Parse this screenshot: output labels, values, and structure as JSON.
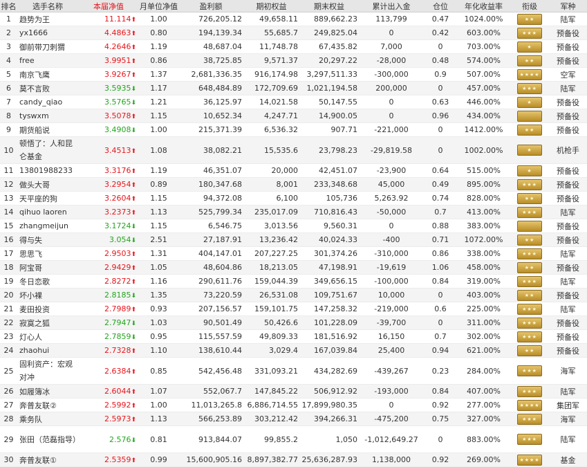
{
  "columns": [
    "排名",
    "选手名称",
    "本届净值",
    "月单位净值",
    "盈利额",
    "期初权益",
    "期末权益",
    "累计出入金",
    "仓位",
    "年化收益率",
    "衔级",
    "军种"
  ],
  "rows": [
    {
      "rank": "1",
      "name": "趋势为王",
      "nav": "11.114",
      "dir": "up",
      "mnav": "1.00",
      "profit": "726,205.12",
      "start": "49,658.11",
      "end": "889,662.23",
      "flow": "113,799",
      "pos": "0.47",
      "annual": "1024.00%",
      "rank_badge": "★★",
      "branch": "陆军"
    },
    {
      "rank": "2",
      "name": "yx1666",
      "nav": "4.4863",
      "dir": "up",
      "mnav": "0.80",
      "profit": "194,139.34",
      "start": "55,685.7",
      "end": "249,825.04",
      "flow": "0",
      "pos": "0.42",
      "annual": "603.00%",
      "rank_badge": "★★★",
      "branch": "预备役"
    },
    {
      "rank": "3",
      "name": "御前带刀刺猬",
      "nav": "4.2646",
      "dir": "up",
      "mnav": "1.19",
      "profit": "48,687.04",
      "start": "11,748.78",
      "end": "67,435.82",
      "flow": "7,000",
      "pos": "0",
      "annual": "703.00%",
      "rank_badge": "★",
      "branch": "预备役"
    },
    {
      "rank": "4",
      "name": "free",
      "nav": "3.9951",
      "dir": "up",
      "mnav": "0.86",
      "profit": "38,725.85",
      "start": "9,571.37",
      "end": "20,297.22",
      "flow": "-28,000",
      "pos": "0.48",
      "annual": "574.00%",
      "rank_badge": "★★",
      "branch": "预备役"
    },
    {
      "rank": "5",
      "name": "南京飞鹰",
      "nav": "3.9267",
      "dir": "up",
      "mnav": "1.37",
      "profit": "2,681,336.35",
      "start": "916,174.98",
      "end": "3,297,511.33",
      "flow": "-300,000",
      "pos": "0.9",
      "annual": "507.00%",
      "rank_badge": "★★★★",
      "branch": "空军"
    },
    {
      "rank": "6",
      "name": "莫不言败",
      "nav": "3.5935",
      "dir": "dn",
      "mnav": "1.17",
      "profit": "648,484.89",
      "start": "172,709.69",
      "end": "1,021,194.58",
      "flow": "200,000",
      "pos": "0",
      "annual": "457.00%",
      "rank_badge": "★★★",
      "branch": "陆军"
    },
    {
      "rank": "7",
      "name": "candy_qiao",
      "nav": "3.5765",
      "dir": "dn",
      "mnav": "1.21",
      "profit": "36,125.97",
      "start": "14,021.58",
      "end": "50,147.55",
      "flow": "0",
      "pos": "0.63",
      "annual": "446.00%",
      "rank_badge": "★",
      "branch": "预备役"
    },
    {
      "rank": "8",
      "name": "tyswxm",
      "nav": "3.5078",
      "dir": "up",
      "mnav": "1.15",
      "profit": "10,652.34",
      "start": "4,247.71",
      "end": "14,900.05",
      "flow": "0",
      "pos": "0.96",
      "annual": "434.00%",
      "rank_badge": "",
      "branch": "预备役"
    },
    {
      "rank": "9",
      "name": "期货船说",
      "nav": "3.4908",
      "dir": "dn",
      "mnav": "1.00",
      "profit": "215,371.39",
      "start": "6,536.32",
      "end": "907.71",
      "flow": "-221,000",
      "pos": "0",
      "annual": "1412.00%",
      "rank_badge": "★★",
      "branch": "预备役"
    },
    {
      "rank": "10",
      "name": "顿悟了：人和昆仑基金",
      "nav": "3.4513",
      "dir": "up",
      "mnav": "1.08",
      "profit": "38,082.21",
      "start": "15,535.6",
      "end": "23,798.23",
      "flow": "-29,819.58",
      "pos": "0",
      "annual": "1002.00%",
      "rank_badge": "★",
      "branch": "机枪手",
      "tall": true
    },
    {
      "rank": "11",
      "name": "13801988233",
      "nav": "3.3176",
      "dir": "up",
      "mnav": "1.19",
      "profit": "46,351.07",
      "start": "20,000",
      "end": "42,451.07",
      "flow": "-23,900",
      "pos": "0.64",
      "annual": "515.00%",
      "rank_badge": "★",
      "branch": "预备役"
    },
    {
      "rank": "12",
      "name": "做头大哥",
      "nav": "3.2954",
      "dir": "up",
      "mnav": "0.89",
      "profit": "180,347.68",
      "start": "8,001",
      "end": "233,348.68",
      "flow": "45,000",
      "pos": "0.49",
      "annual": "895.00%",
      "rank_badge": "★★★",
      "branch": "预备役"
    },
    {
      "rank": "13",
      "name": "天平座的狗",
      "nav": "3.2604",
      "dir": "up",
      "mnav": "1.15",
      "profit": "94,372.08",
      "start": "6,100",
      "end": "105,736",
      "flow": "5,263.92",
      "pos": "0.74",
      "annual": "828.00%",
      "rank_badge": "★★",
      "branch": "预备役"
    },
    {
      "rank": "14",
      "name": "qihuo laoren",
      "nav": "3.2373",
      "dir": "up",
      "mnav": "1.13",
      "profit": "525,799.34",
      "start": "235,017.09",
      "end": "710,816.43",
      "flow": "-50,000",
      "pos": "0.7",
      "annual": "413.00%",
      "rank_badge": "★★★",
      "branch": "陆军"
    },
    {
      "rank": "15",
      "name": "zhangmeijun",
      "nav": "3.1724",
      "dir": "dn",
      "mnav": "1.15",
      "profit": "6,546.75",
      "start": "3,013.56",
      "end": "9,560.31",
      "flow": "0",
      "pos": "0.88",
      "annual": "383.00%",
      "rank_badge": "",
      "branch": "预备役"
    },
    {
      "rank": "16",
      "name": "得与失",
      "nav": "3.054",
      "dir": "dn",
      "mnav": "2.51",
      "profit": "27,187.91",
      "start": "13,236.42",
      "end": "40,024.33",
      "flow": "-400",
      "pos": "0.71",
      "annual": "1072.00%",
      "rank_badge": "★★",
      "branch": "预备役"
    },
    {
      "rank": "17",
      "name": "思思飞",
      "nav": "2.9503",
      "dir": "up",
      "mnav": "1.31",
      "profit": "404,147.01",
      "start": "207,227.25",
      "end": "301,374.26",
      "flow": "-310,000",
      "pos": "0.86",
      "annual": "338.00%",
      "rank_badge": "★★★",
      "branch": "陆军"
    },
    {
      "rank": "18",
      "name": "阿宝哥",
      "nav": "2.9429",
      "dir": "up",
      "mnav": "1.05",
      "profit": "48,604.86",
      "start": "18,213.05",
      "end": "47,198.91",
      "flow": "-19,619",
      "pos": "1.06",
      "annual": "458.00%",
      "rank_badge": "★★",
      "branch": "预备役"
    },
    {
      "rank": "19",
      "name": "冬日恋歌",
      "nav": "2.8272",
      "dir": "up",
      "mnav": "1.16",
      "profit": "290,611.76",
      "start": "159,044.39",
      "end": "349,656.15",
      "flow": "-100,000",
      "pos": "0.84",
      "annual": "319.00%",
      "rank_badge": "★★★",
      "branch": "陆军"
    },
    {
      "rank": "20",
      "name": "坏小裸",
      "nav": "2.8185",
      "dir": "dn",
      "mnav": "1.35",
      "profit": "73,220.59",
      "start": "26,531.08",
      "end": "109,751.67",
      "flow": "10,000",
      "pos": "0",
      "annual": "403.00%",
      "rank_badge": "★★",
      "branch": "预备役"
    },
    {
      "rank": "21",
      "name": "麦田投资",
      "nav": "2.7989",
      "dir": "up",
      "mnav": "0.93",
      "profit": "207,156.57",
      "start": "159,101.75",
      "end": "147,258.32",
      "flow": "-219,000",
      "pos": "0.6",
      "annual": "225.00%",
      "rank_badge": "★★★",
      "branch": "陆军"
    },
    {
      "rank": "22",
      "name": "寂寞之狐",
      "nav": "2.7947",
      "dir": "dn",
      "mnav": "1.03",
      "profit": "90,501.49",
      "start": "50,426.6",
      "end": "101,228.09",
      "flow": "-39,700",
      "pos": "0",
      "annual": "311.00%",
      "rank_badge": "★★★",
      "branch": "预备役"
    },
    {
      "rank": "23",
      "name": "灯心人",
      "nav": "2.7859",
      "dir": "dn",
      "mnav": "0.95",
      "profit": "115,557.59",
      "start": "49,809.33",
      "end": "181,516.92",
      "flow": "16,150",
      "pos": "0.7",
      "annual": "302.00%",
      "rank_badge": "★★★",
      "branch": "预备役"
    },
    {
      "rank": "24",
      "name": "zhaohui",
      "nav": "2.7328",
      "dir": "up",
      "mnav": "1.10",
      "profit": "138,610.44",
      "start": "3,029.4",
      "end": "167,039.84",
      "flow": "25,400",
      "pos": "0.94",
      "annual": "621.00%",
      "rank_badge": "★★",
      "branch": "预备役"
    },
    {
      "rank": "25",
      "name": "固利资产：宏观对冲",
      "nav": "2.6384",
      "dir": "up",
      "mnav": "0.85",
      "profit": "542,456.48",
      "start": "331,093.21",
      "end": "434,282.69",
      "flow": "-439,267",
      "pos": "0.23",
      "annual": "284.00%",
      "rank_badge": "★★★",
      "branch": "海军",
      "tall": true
    },
    {
      "rank": "26",
      "name": "如履簿冰",
      "nav": "2.6044",
      "dir": "up",
      "mnav": "1.07",
      "profit": "552,067.7",
      "start": "147,845.22",
      "end": "506,912.92",
      "flow": "-193,000",
      "pos": "0.84",
      "annual": "407.00%",
      "rank_badge": "★★★",
      "branch": "陆军"
    },
    {
      "rank": "27",
      "name": "奔普友联②",
      "nav": "2.5992",
      "dir": "up",
      "mnav": "1.00",
      "profit": "11,013,265.8",
      "start": "6,886,714.55",
      "end": "17,899,980.35",
      "flow": "0",
      "pos": "0.92",
      "annual": "277.00%",
      "rank_badge": "★★★★",
      "branch": "集团军"
    },
    {
      "rank": "28",
      "name": "乘务队",
      "nav": "2.5973",
      "dir": "up",
      "mnav": "1.13",
      "profit": "566,253.89",
      "start": "303,212.42",
      "end": "394,266.31",
      "flow": "-475,200",
      "pos": "0.75",
      "annual": "327.00%",
      "rank_badge": "★★★",
      "branch": "海军"
    },
    {
      "rank": "29",
      "name": "张田（范磊指导）",
      "nav": "2.576",
      "dir": "dn",
      "mnav": "0.81",
      "profit": "913,844.07",
      "start": "99,855.2",
      "end": "1,050",
      "flow": "-1,012,649.27",
      "pos": "0",
      "annual": "883.00%",
      "rank_badge": "★★★",
      "branch": "陆军",
      "tall": true
    },
    {
      "rank": "30",
      "name": "奔普友联①",
      "nav": "2.5359",
      "dir": "up",
      "mnav": "0.99",
      "profit": "15,600,905.16",
      "start": "8,897,382.77",
      "end": "25,636,287.93",
      "flow": "1,138,000",
      "pos": "0.92",
      "annual": "269.00%",
      "rank_badge": "★★★★",
      "branch": "基金"
    }
  ],
  "colors": {
    "up": "#e8141b",
    "down": "#22a51e",
    "badge": "#d2ab4a"
  }
}
